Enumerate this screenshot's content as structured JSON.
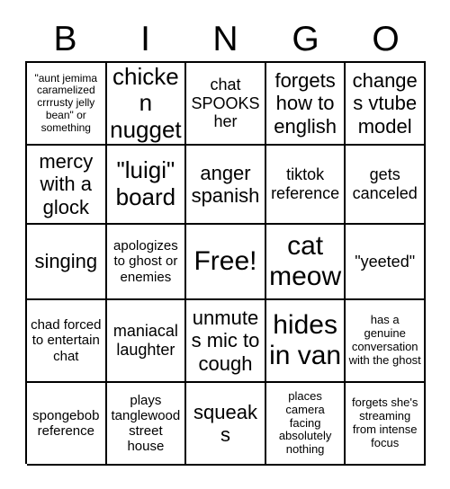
{
  "header": {
    "letters": [
      "B",
      "I",
      "N",
      "G",
      "O"
    ]
  },
  "grid": {
    "rows": [
      [
        {
          "text": "\"aunt jemima caramelized crrrusty jelly bean\" or something",
          "size": "fs-xxs"
        },
        {
          "text": "chicken nugget",
          "size": "fs-xl"
        },
        {
          "text": "chat SPOOKS her",
          "size": "fs-m"
        },
        {
          "text": "forgets how to english",
          "size": "fs-l"
        },
        {
          "text": "changes vtube model",
          "size": "fs-l"
        }
      ],
      [
        {
          "text": "mercy with a glock",
          "size": "fs-l"
        },
        {
          "text": "\"luigi\" board",
          "size": "fs-xl"
        },
        {
          "text": "anger spanish",
          "size": "fs-l"
        },
        {
          "text": "tiktok reference",
          "size": "fs-m"
        },
        {
          "text": "gets canceled",
          "size": "fs-m"
        }
      ],
      [
        {
          "text": "singing",
          "size": "fs-l"
        },
        {
          "text": "apologizes to ghost or enemies",
          "size": "fs-s"
        },
        {
          "text": "Free!",
          "size": "fs-xxl"
        },
        {
          "text": "cat meow",
          "size": "fs-xxl"
        },
        {
          "text": "\"yeeted\"",
          "size": "fs-m"
        }
      ],
      [
        {
          "text": "chad forced to entertain chat",
          "size": "fs-s"
        },
        {
          "text": "maniacal laughter",
          "size": "fs-m"
        },
        {
          "text": "unmutes mic to cough",
          "size": "fs-l"
        },
        {
          "text": "hides in van",
          "size": "fs-xxl"
        },
        {
          "text": "has a genuine conversation with the ghost",
          "size": "fs-xs"
        }
      ],
      [
        {
          "text": "spongebob reference",
          "size": "fs-s"
        },
        {
          "text": "plays tanglewood street house",
          "size": "fs-s"
        },
        {
          "text": "squeaks",
          "size": "fs-l"
        },
        {
          "text": "places camera facing absolutely nothing",
          "size": "fs-xs"
        },
        {
          "text": "forgets she's streaming from intense focus",
          "size": "fs-xs"
        }
      ]
    ]
  },
  "colors": {
    "border": "#000000",
    "background": "#ffffff",
    "text": "#000000"
  }
}
